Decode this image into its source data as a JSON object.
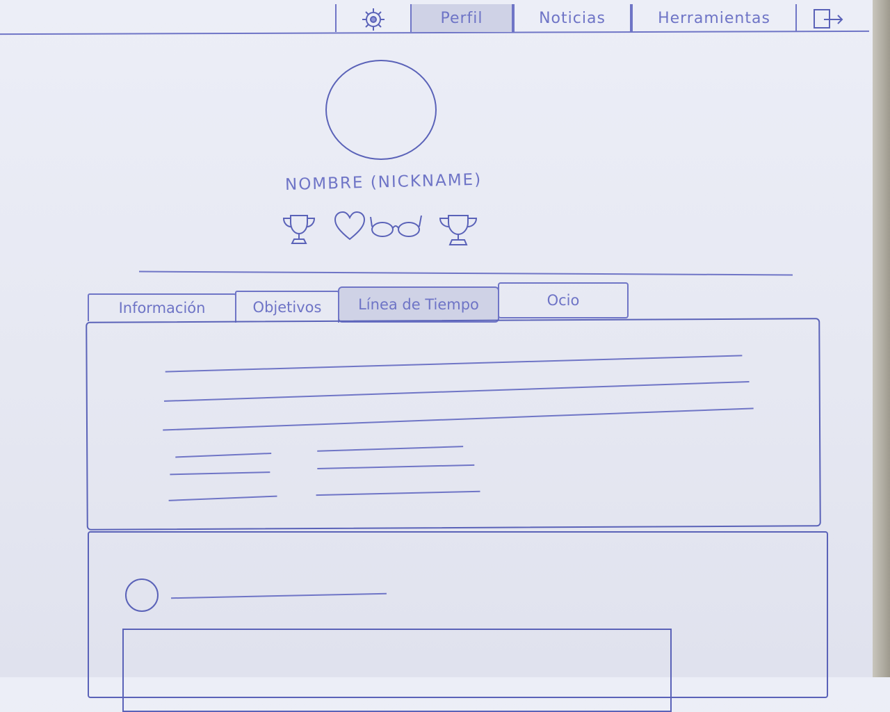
{
  "nav": {
    "settings_icon": "gear-icon",
    "items": [
      {
        "label": "Perfil",
        "active": true
      },
      {
        "label": "Noticias",
        "active": false
      },
      {
        "label": "Herramientas",
        "active": false
      }
    ],
    "logout_icon": "logout-icon"
  },
  "profile": {
    "username": "NOMBRE (NICKNAME)",
    "badges": [
      "trophy-icon",
      "heart-icon",
      "glasses-icon",
      "trophy-icon"
    ]
  },
  "tabs": [
    {
      "label": "Información",
      "active": false
    },
    {
      "label": "Objetivos",
      "active": false
    },
    {
      "label": "Línea de Tiempo",
      "active": true
    },
    {
      "label": "Ocio",
      "active": false
    }
  ],
  "colors": {
    "ink": "#5a62b8",
    "active_fill": "#cfd2e6",
    "paper": "#e6e8f2"
  }
}
